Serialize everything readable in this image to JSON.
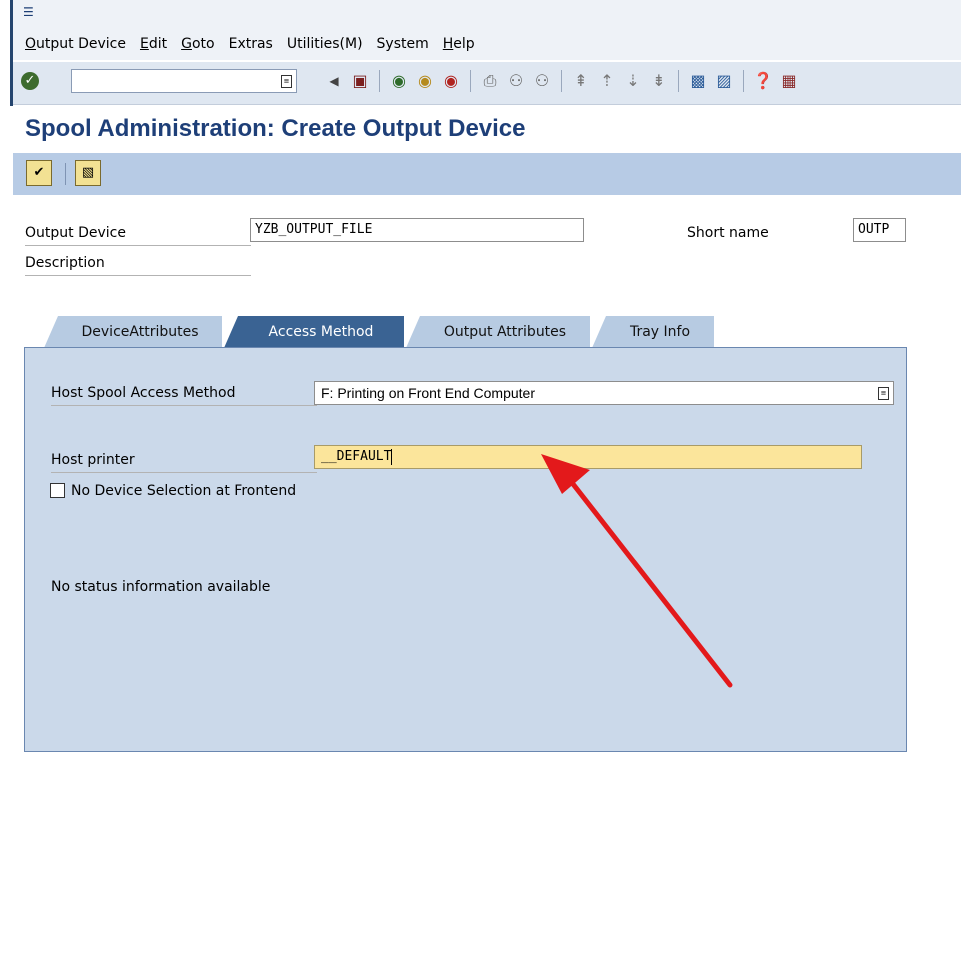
{
  "menubar": {
    "items": [
      "Output Device",
      "Edit",
      "Goto",
      "Extras",
      "Utilities(M)",
      "System",
      "Help"
    ]
  },
  "toolbar": {
    "command_field_value": "",
    "icons": [
      "enter-icon",
      "dropdown-icon",
      "back-triangle-icon",
      "save-icon",
      "back-icon",
      "exit-icon",
      "cancel-icon",
      "print-icon",
      "find-icon",
      "find-next-icon",
      "first-page-icon",
      "previous-page-icon",
      "next-page-icon",
      "last-page-icon",
      "new-session-icon",
      "shortcut-icon",
      "help-icon",
      "layout-icon"
    ]
  },
  "page": {
    "title": "Spool Administration: Create Output Device"
  },
  "app_toolbar": {
    "icons": [
      "check-icon",
      "change-icon"
    ]
  },
  "form": {
    "output_device_label": "Output Device",
    "output_device_value": "YZB_OUTPUT_FILE",
    "short_name_label": "Short name",
    "short_name_value": "OUTP",
    "description_label": "Description"
  },
  "tabs": [
    {
      "label": "DeviceAttributes",
      "active": false
    },
    {
      "label": "Access Method",
      "active": true
    },
    {
      "label": "Output Attributes",
      "active": false
    },
    {
      "label": "Tray Info",
      "active": false
    }
  ],
  "access_method": {
    "host_spool_label": "Host Spool Access Method",
    "host_spool_value": "F: Printing on Front End Computer",
    "host_printer_label": "Host printer",
    "host_printer_value": "__DEFAULT",
    "no_device_selection_label": "No Device Selection at Frontend",
    "no_device_selection_checked": false,
    "status_text": "No status information available"
  },
  "colors": {
    "title": "#1e3f78",
    "tab_active": "#3a6393",
    "panel_bg": "#cbd9ea",
    "highlight_field": "#fbe59b",
    "arrow": "#e3191b"
  }
}
